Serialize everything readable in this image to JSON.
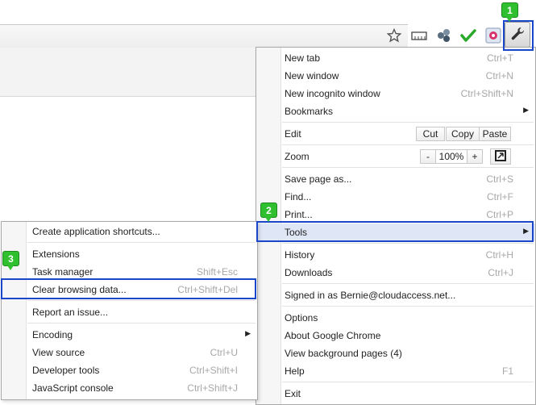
{
  "colors": {
    "highlight": "#1a47c9",
    "badge": "#2fbf2f",
    "shortcut": "#a8a8a8"
  },
  "toolbar": {
    "icons": [
      "star-icon",
      "ruler-icon",
      "cube-icon",
      "checkmark-icon",
      "gear-extension-icon",
      "wrench-icon"
    ]
  },
  "badges": {
    "one": "1",
    "two": "2",
    "three": "3"
  },
  "main_menu": {
    "new_tab": {
      "label": "New tab",
      "shortcut": "Ctrl+T"
    },
    "new_window": {
      "label": "New window",
      "shortcut": "Ctrl+N"
    },
    "new_incognito": {
      "label": "New incognito window",
      "shortcut": "Ctrl+Shift+N"
    },
    "bookmarks": {
      "label": "Bookmarks"
    },
    "edit": {
      "label": "Edit",
      "cut": "Cut",
      "copy": "Copy",
      "paste": "Paste"
    },
    "zoom": {
      "label": "Zoom",
      "minus": "-",
      "level": "100%",
      "plus": "+"
    },
    "save_page": {
      "label": "Save page as...",
      "shortcut": "Ctrl+S"
    },
    "find": {
      "label": "Find...",
      "shortcut": "Ctrl+F"
    },
    "print": {
      "label": "Print...",
      "shortcut": "Ctrl+P"
    },
    "tools": {
      "label": "Tools"
    },
    "history": {
      "label": "History",
      "shortcut": "Ctrl+H"
    },
    "downloads": {
      "label": "Downloads",
      "shortcut": "Ctrl+J"
    },
    "signed_in": {
      "label": "Signed in as Bernie@cloudaccess.net..."
    },
    "options": {
      "label": "Options"
    },
    "about": {
      "label": "About Google Chrome"
    },
    "background_pages": {
      "label": "View background pages (4)"
    },
    "help": {
      "label": "Help",
      "shortcut": "F1"
    },
    "exit": {
      "label": "Exit"
    }
  },
  "tools_menu": {
    "create_shortcuts": {
      "label": "Create application shortcuts..."
    },
    "extensions": {
      "label": "Extensions"
    },
    "task_manager": {
      "label": "Task manager",
      "shortcut": "Shift+Esc"
    },
    "clear_browsing": {
      "label": "Clear browsing data...",
      "shortcut": "Ctrl+Shift+Del"
    },
    "report_issue": {
      "label": "Report an issue..."
    },
    "encoding": {
      "label": "Encoding"
    },
    "view_source": {
      "label": "View source",
      "shortcut": "Ctrl+U"
    },
    "developer_tools": {
      "label": "Developer tools",
      "shortcut": "Ctrl+Shift+I"
    },
    "javascript_console": {
      "label": "JavaScript console",
      "shortcut": "Ctrl+Shift+J"
    }
  }
}
